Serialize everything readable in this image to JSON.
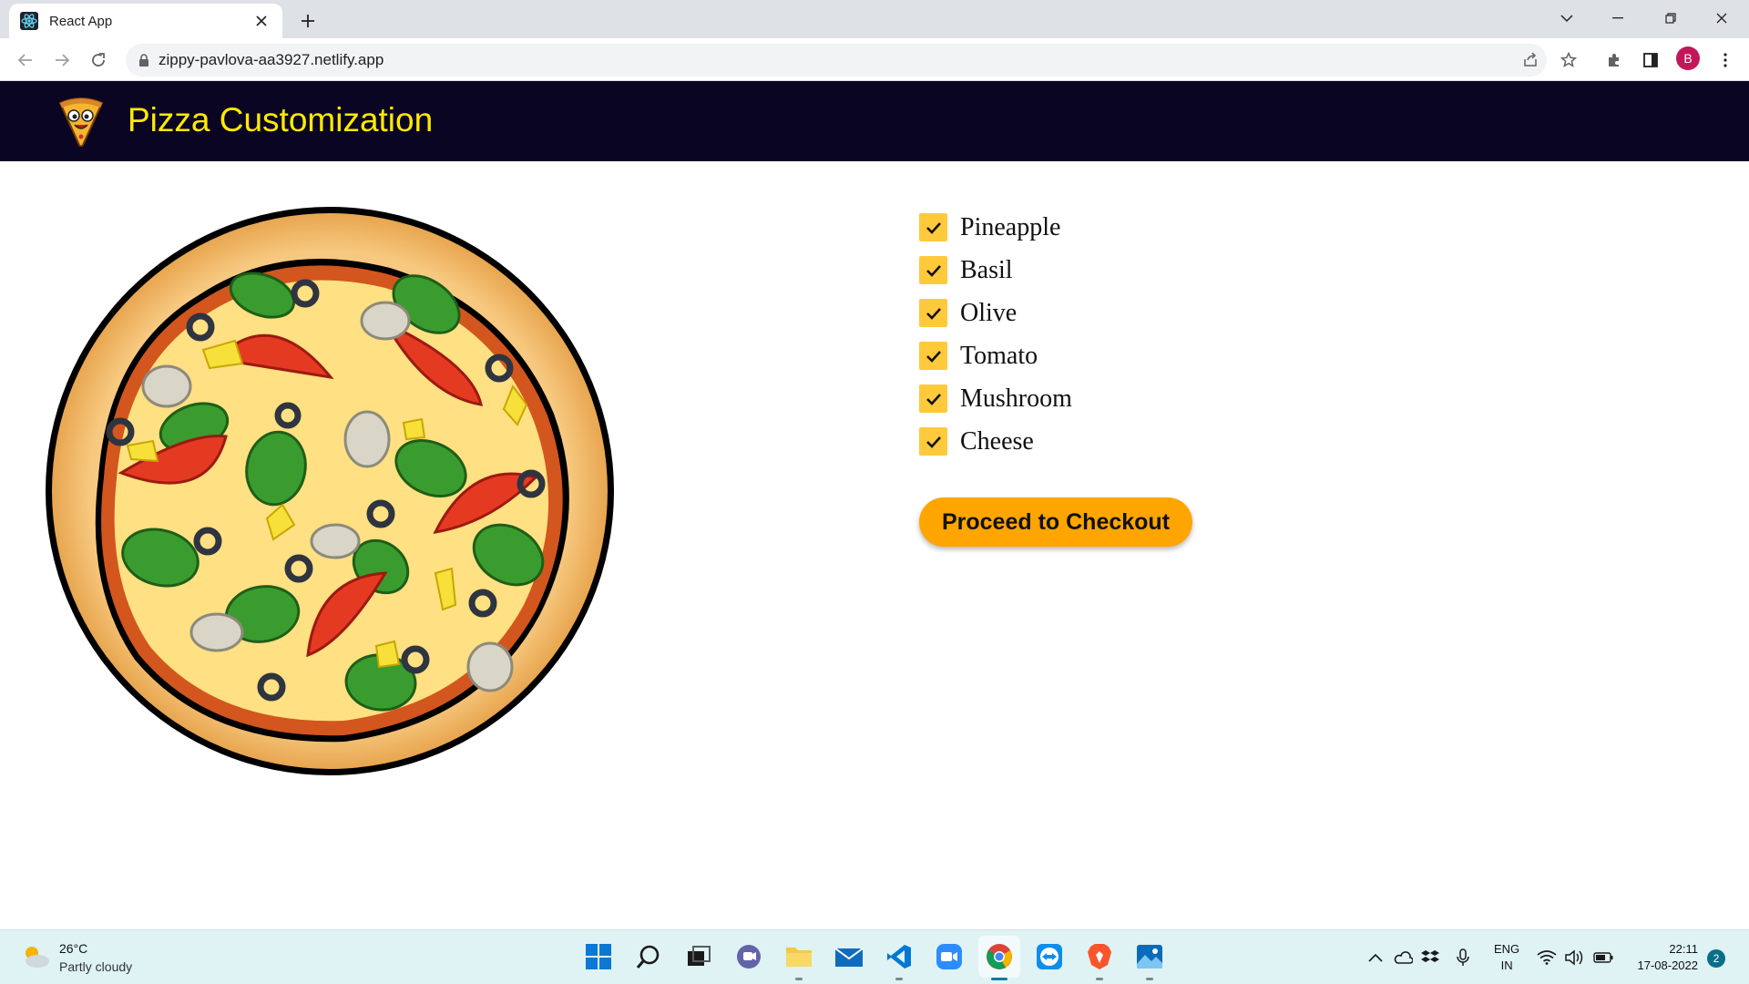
{
  "browser": {
    "tab_title": "React App",
    "url": "zippy-pavlova-aa3927.netlify.app",
    "profile_initial": "B"
  },
  "app": {
    "title": "Pizza Customization"
  },
  "toppings": [
    {
      "label": "Pineapple",
      "checked": true
    },
    {
      "label": "Basil",
      "checked": true
    },
    {
      "label": "Olive",
      "checked": true
    },
    {
      "label": "Tomato",
      "checked": true
    },
    {
      "label": "Mushroom",
      "checked": true
    },
    {
      "label": "Cheese",
      "checked": true
    }
  ],
  "checkout_label": "Proceed to Checkout",
  "colors": {
    "header_bg": "#0b0524",
    "header_title": "#ffeb00",
    "checkbox": "#ffc93c",
    "checkout_bg": "#ffa500"
  },
  "taskbar": {
    "weather_temp": "26°C",
    "weather_desc": "Partly cloudy",
    "lang_top": "ENG",
    "lang_bottom": "IN",
    "time": "22:11",
    "date": "17-08-2022",
    "notifications": "2"
  }
}
